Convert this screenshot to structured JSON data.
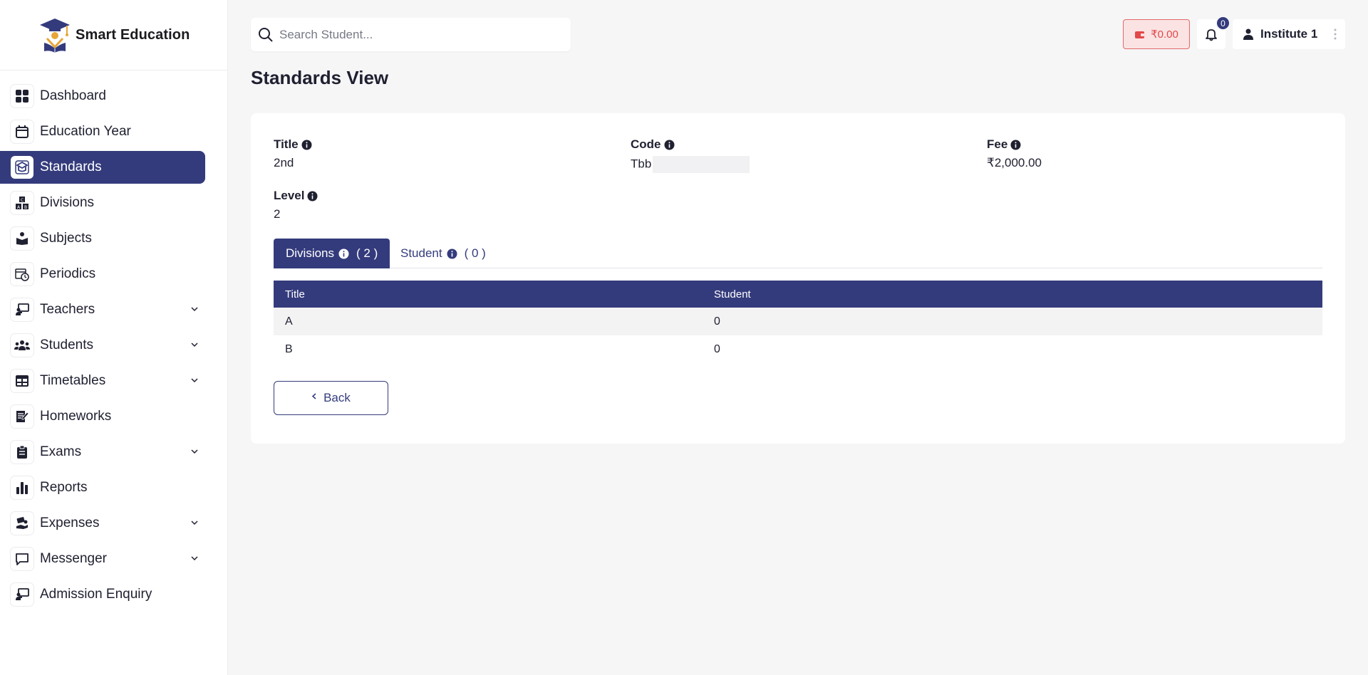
{
  "app": {
    "brand_name": "Smart Education"
  },
  "sidebar": {
    "items": [
      {
        "label": "Dashboard",
        "icon": "dashboard-icon",
        "active": false,
        "expandable": false
      },
      {
        "label": "Education Year",
        "icon": "calendar-icon",
        "active": false,
        "expandable": false
      },
      {
        "label": "Standards",
        "icon": "graduation-cap-icon",
        "active": true,
        "expandable": false
      },
      {
        "label": "Divisions",
        "icon": "abc-blocks-icon",
        "active": false,
        "expandable": false
      },
      {
        "label": "Subjects",
        "icon": "reading-person-icon",
        "active": false,
        "expandable": false
      },
      {
        "label": "Periodics",
        "icon": "calendar-clock-icon",
        "active": false,
        "expandable": false
      },
      {
        "label": "Teachers",
        "icon": "chalkboard-teacher-icon",
        "active": false,
        "expandable": true
      },
      {
        "label": "Students",
        "icon": "users-icon",
        "active": false,
        "expandable": true
      },
      {
        "label": "Timetables",
        "icon": "table-icon",
        "active": false,
        "expandable": true
      },
      {
        "label": "Homeworks",
        "icon": "notepad-pen-icon",
        "active": false,
        "expandable": false
      },
      {
        "label": "Exams",
        "icon": "clipboard-icon",
        "active": false,
        "expandable": true
      },
      {
        "label": "Reports",
        "icon": "bar-chart-icon",
        "active": false,
        "expandable": false
      },
      {
        "label": "Expenses",
        "icon": "money-hand-icon",
        "active": false,
        "expandable": true
      },
      {
        "label": "Messenger",
        "icon": "chat-bubble-icon",
        "active": false,
        "expandable": true
      },
      {
        "label": "Admission Enquiry",
        "icon": "chalkboard-teacher-icon",
        "active": false,
        "expandable": false
      }
    ]
  },
  "header": {
    "search_placeholder": "Search Student...",
    "wallet_balance": "₹0.00",
    "notification_count": "0",
    "user_name": "Institute 1"
  },
  "page": {
    "title": "Standards View",
    "fields": {
      "title_label": "Title",
      "title_value": "2nd",
      "code_label": "Code",
      "code_value": "Tbb",
      "fee_label": "Fee",
      "fee_value": "₹2,000.00",
      "level_label": "Level",
      "level_value": "2"
    },
    "tabs": [
      {
        "label": "Divisions",
        "count": "( 2 )",
        "active": true
      },
      {
        "label": "Student",
        "count": "( 0 )",
        "active": false
      }
    ],
    "table": {
      "columns": [
        "Title",
        "Student"
      ],
      "rows": [
        [
          "A",
          "0"
        ],
        [
          "B",
          "0"
        ]
      ]
    },
    "back_label": "Back"
  },
  "colors": {
    "primary": "#343b7c",
    "danger": "#e24848",
    "danger_bg": "#fbe3e3",
    "background": "#f6f6f7"
  }
}
